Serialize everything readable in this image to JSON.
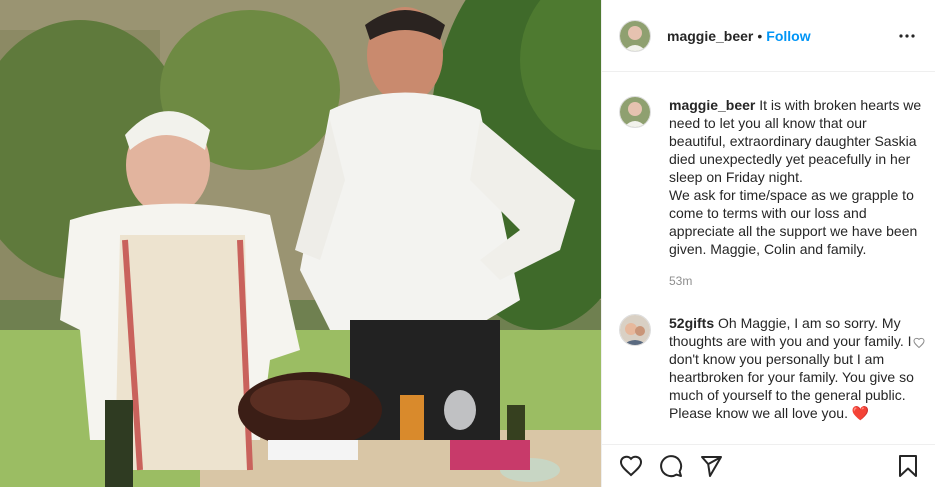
{
  "post": {
    "username": "maggie_beer",
    "separator": "•",
    "follow_label": "Follow",
    "more_icon": "more-options-icon"
  },
  "caption": {
    "username": "maggie_beer",
    "text_1": "It is with broken hearts we need to let you all know that our beautiful, extraordinary daughter Saskia died unexpectedly yet peacefully in her sleep on Friday night.",
    "text_2": "We ask for time/space as we grapple to come to terms with our loss and appreciate all the support we have been given. Maggie, Colin and family.",
    "time": "53m"
  },
  "comment": {
    "username": "52gifts",
    "text": "Oh Maggie, I am so sorry. My thoughts are with you and your family. I don't know you personally but I am heartbroken for your family. You give so much of yourself to the general public. Please know we all love you. ",
    "emoji": "❤️"
  },
  "actions": [
    "heart-icon",
    "comment-icon",
    "share-icon",
    "bookmark-icon"
  ],
  "colors": {
    "follow": "#0095f6",
    "heart_emoji": "#e0245e"
  }
}
